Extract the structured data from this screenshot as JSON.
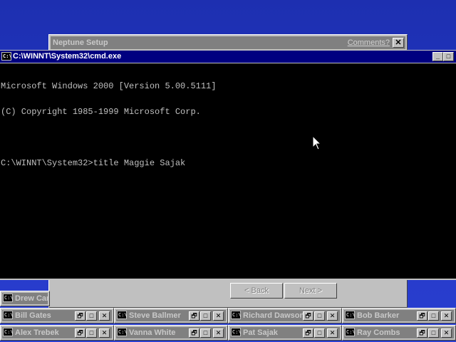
{
  "setup_window": {
    "title": "Neptune Setup",
    "comments_link": "Comments?",
    "close_glyph": "✕",
    "back_label": "< Back",
    "next_label": "Next >"
  },
  "cmd_window": {
    "title": "C:\\WINNT\\System32\\cmd.exe",
    "icon_text": "C:\\",
    "minimize_glyph": "_",
    "maximize_glyph": "□",
    "console_lines": [
      "Microsoft Windows 2000 [Version 5.00.5111]",
      "(C) Copyright 1985-1999 Microsoft Corp.",
      "",
      "C:\\WINNT\\System32>title Maggie Sajak"
    ]
  },
  "minimized_windows": {
    "partial": "Drew Carey",
    "row1": [
      "Bill Gates",
      "Steve Ballmer",
      "Richard Dawson",
      "Bob Barker"
    ],
    "row2": [
      "Alex Trebek",
      "Vanna White",
      "Pat Sajak",
      "Ray Combs"
    ],
    "restore_glyph": "🗗",
    "max_glyph": "□",
    "close_glyph": "✕"
  },
  "colors": {
    "desktop": "#2236c4",
    "active_title": "#000080",
    "inactive_title": "#808080",
    "console_bg": "#000000",
    "console_text": "#c0c0c0"
  },
  "icons": {
    "cmd": "cmd-icon",
    "pointer": "mouse-pointer-icon"
  }
}
